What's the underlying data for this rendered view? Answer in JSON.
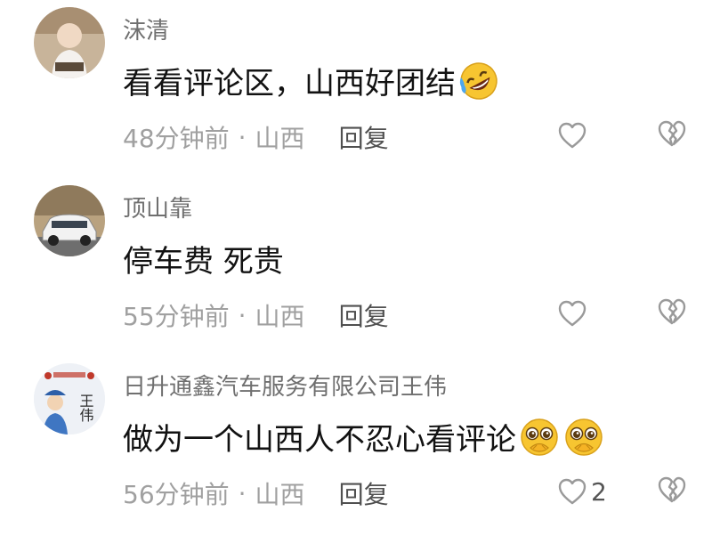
{
  "comments": [
    {
      "username": "沫清",
      "text": "看看评论区，山西好团结",
      "emojis": [
        "rolling-laughing-emoji"
      ],
      "time": "48分钟前",
      "location": "山西",
      "reply_label": "回复",
      "like_count": ""
    },
    {
      "username": "顶山靠",
      "text": "停车费 死贵",
      "emojis": [],
      "time": "55分钟前",
      "location": "山西",
      "reply_label": "回复",
      "like_count": ""
    },
    {
      "username": "日升通鑫汽车服务有限公司王伟",
      "text": "做为一个山西人不忍心看评论",
      "emojis": [
        "pleading-face-emoji",
        "pleading-face-emoji"
      ],
      "time": "56分钟前",
      "location": "山西",
      "reply_label": "回复",
      "like_count": "2"
    }
  ],
  "separator": "·",
  "avatar3_text": "王伟",
  "colors": {
    "username": "#6f6f6f",
    "content": "#121212",
    "meta": "#a0a0a0",
    "reply": "#505050",
    "icon": "#9a9a9a"
  }
}
